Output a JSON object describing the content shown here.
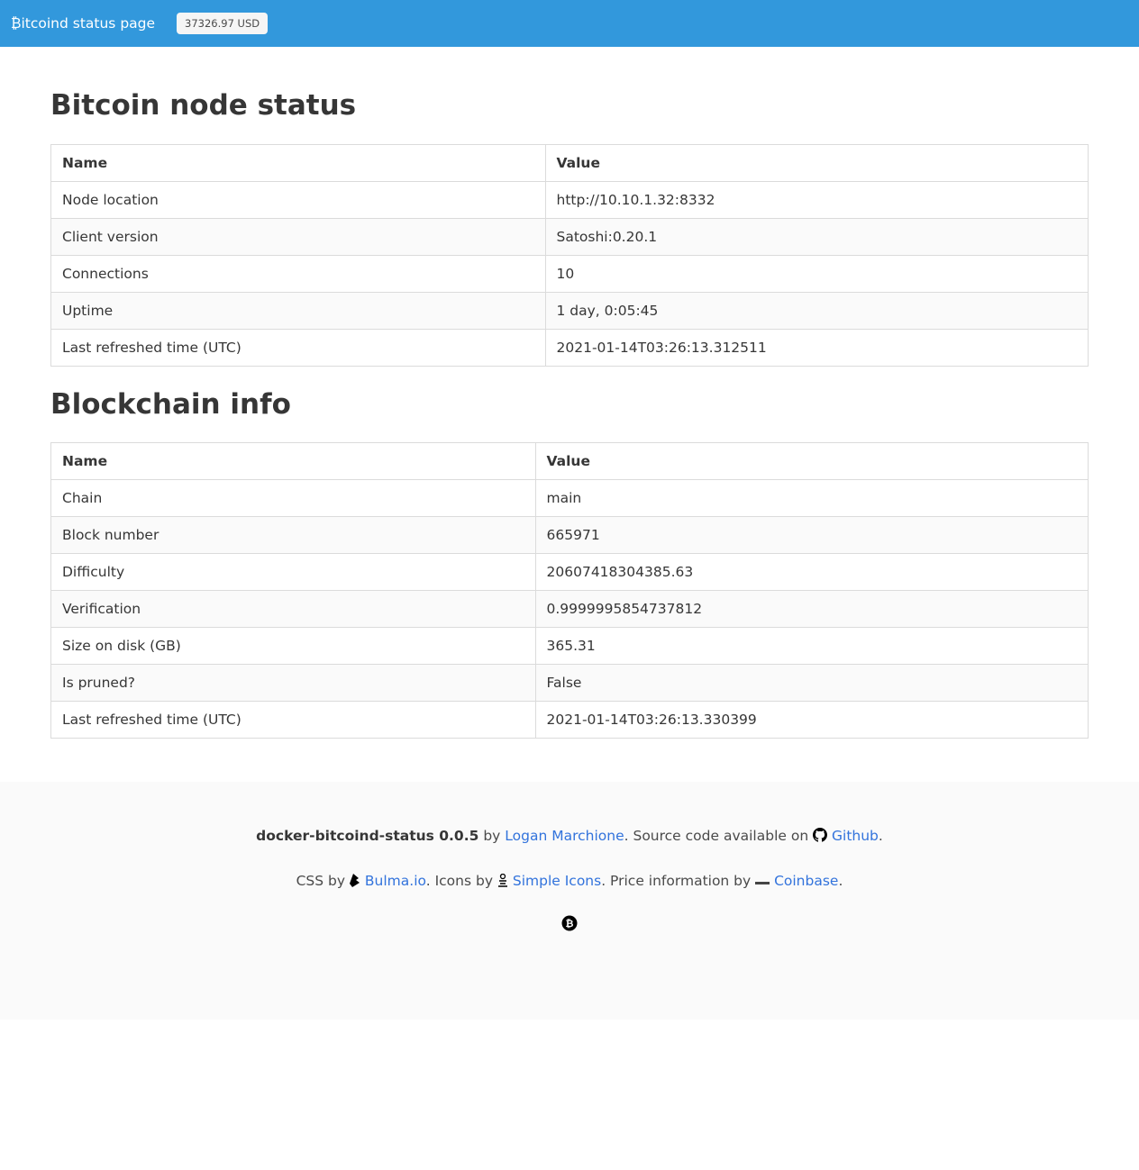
{
  "navbar": {
    "brand": "₿itcoind status page",
    "price": "37326.97 USD"
  },
  "node_status": {
    "title": "Bitcoin node status",
    "headers": [
      "Name",
      "Value"
    ],
    "rows": [
      {
        "name": "Node location",
        "value": "http://10.10.1.32:8332"
      },
      {
        "name": "Client version",
        "value": "Satoshi:0.20.1"
      },
      {
        "name": "Connections",
        "value": "10"
      },
      {
        "name": "Uptime",
        "value": "1 day, 0:05:45"
      },
      {
        "name": "Last refreshed time (UTC)",
        "value": "2021-01-14T03:26:13.312511"
      }
    ]
  },
  "blockchain_info": {
    "title": "Blockchain info",
    "headers": [
      "Name",
      "Value"
    ],
    "rows": [
      {
        "name": "Chain",
        "value": "main"
      },
      {
        "name": "Block number",
        "value": "665971"
      },
      {
        "name": "Difficulty",
        "value": "20607418304385.63"
      },
      {
        "name": "Verification",
        "value": "0.9999995854737812"
      },
      {
        "name": "Size on disk (GB)",
        "value": "365.31"
      },
      {
        "name": "Is pruned?",
        "value": "False"
      },
      {
        "name": "Last refreshed time (UTC)",
        "value": "2021-01-14T03:26:13.330399"
      }
    ]
  },
  "footer": {
    "project": "docker-bitcoind-status 0.0.5",
    "by": " by ",
    "author": "Logan Marchione",
    "source_text": ". Source code available on ",
    "github": "Github",
    "end1": ".",
    "css_by": "CSS by ",
    "bulma": "Bulma.io",
    "icons_by": ". Icons by ",
    "simple_icons": "Simple Icons",
    "price_by": ". Price information by ",
    "coinbase": "Coinbase",
    "end2": "."
  },
  "icons": [
    "bulma-icon",
    "simple-icons-icon",
    "coinbase-icon",
    "github-icon",
    "bitcoin-icon"
  ],
  "colors": {
    "navbar": "#3298dc",
    "link": "#3273dc"
  }
}
